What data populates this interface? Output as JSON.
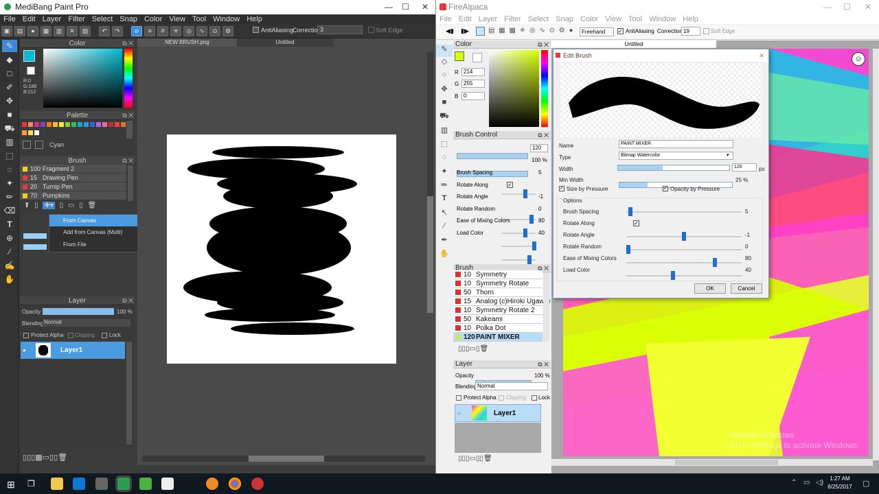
{
  "medibang": {
    "title": "MediBang Paint Pro",
    "menu": [
      "File",
      "Edit",
      "Layer",
      "Filter",
      "Select",
      "Snap",
      "Color",
      "View",
      "Tool",
      "Window",
      "Help"
    ],
    "toolbar": {
      "antialiasing": "AntiAliasing",
      "correction_label": "Correction",
      "correction_value": "3",
      "soft_edge": "Soft Edge"
    },
    "tabs": [
      "NEW BRUSH.png",
      "Untitled"
    ],
    "color_panel": {
      "title": "Color",
      "readout": "R:0\nG:188\nB:212",
      "accent": "#00bcd4"
    },
    "palette_panel": {
      "title": "Palette",
      "selected_name": "Cyan"
    },
    "brush_panel": {
      "title": "Brush",
      "items": [
        {
          "size": "100",
          "name": "Fragment 2",
          "color": "#f2d21b"
        },
        {
          "size": "15",
          "name": "Drawing Pen",
          "color": "#e03c3c"
        },
        {
          "size": "20",
          "name": "Turnip Pen",
          "color": "#e03c3c"
        },
        {
          "size": "70",
          "name": "Pumpkins",
          "color": "#f2d21b"
        }
      ]
    },
    "context_menu": [
      "From Canvas",
      "Add from Canvas (Multi)",
      "From File"
    ],
    "layer_panel": {
      "title": "Layer",
      "opacity_label": "Opacity",
      "opacity_value": "100 %",
      "blending_label": "Blending",
      "blending_value": "Normal",
      "protect_alpha": "Protect Alpha",
      "clipping": "Clipping",
      "lock": "Lock",
      "layer_name": "Layer1"
    }
  },
  "firealpaca": {
    "title": "FireAlpaca",
    "menu": [
      "File",
      "Edit",
      "Layer",
      "Filter",
      "Select",
      "Snap",
      "Color",
      "View",
      "Tool",
      "Window",
      "Help"
    ],
    "toolbar": {
      "mode": "Freehand",
      "antialiasing": "AntiAliasing",
      "correction_label": "Correction",
      "correction_value": "19",
      "soft_edge": "Soft Edge"
    },
    "tab": "Untitled",
    "color_panel": {
      "title": "Color",
      "r_label": "R",
      "r": "214",
      "g_label": "G",
      "g": "255",
      "b_label": "B",
      "b": "0",
      "current_color": "#d6ff00"
    },
    "brush_control": {
      "title": "Brush Control",
      "size": "120",
      "opacity": "100 %",
      "rows": [
        {
          "label": "Brush Spacing",
          "value": "5"
        },
        {
          "label": "Rotate Along",
          "value": ""
        },
        {
          "label": "Rotate Angle",
          "value": "-1"
        },
        {
          "label": "Rotate Random",
          "value": "0"
        },
        {
          "label": "Ease of Mixing Colors",
          "value": "80"
        },
        {
          "label": "Load Color",
          "value": "40"
        }
      ]
    },
    "brush_list": {
      "title": "Brush",
      "items": [
        {
          "size": "10",
          "name": "Symmetry"
        },
        {
          "size": "10",
          "name": "Symmetry Rotate"
        },
        {
          "size": "50",
          "name": "Thorn"
        },
        {
          "size": "15",
          "name": "Analog (c)Hiroki Ugawa)"
        },
        {
          "size": "10",
          "name": "Symmetry Rotate 2"
        },
        {
          "size": "50",
          "name": "Kakeami"
        },
        {
          "size": "10",
          "name": "Polka Dot"
        },
        {
          "size": "120",
          "name": "PAINT MIXER"
        }
      ]
    },
    "layer_panel": {
      "title": "Layer",
      "opacity_label": "Opacity",
      "opacity_value": "100 %",
      "blending_label": "Blending",
      "blending_value": "Normal",
      "protect_alpha": "Protect Alpha",
      "clipping": "Clipping",
      "lock": "Lock",
      "layer_name": "Layer1"
    },
    "watermark": "Activate Windows\nGo to Settings to activate Windows."
  },
  "edit_brush": {
    "title": "Edit Brush",
    "name_label": "Name",
    "name_value": "PAINT MIXER",
    "type_label": "Type",
    "type_value": "Bitmap Watercolor",
    "width_label": "Width",
    "width_value": "120",
    "width_unit": "px",
    "min_width_label": "Min Width",
    "min_width_value": "25 %",
    "size_by_pressure": "Size by Pressure",
    "opacity_by_pressure": "Opacity by Pressure",
    "options_label": "Options",
    "rows": [
      {
        "label": "Brush Spacing",
        "value": "5",
        "level": 0.02
      },
      {
        "label": "Rotate Along",
        "value": ""
      },
      {
        "label": "Rotate Angle",
        "value": "-1",
        "level": 0.5
      },
      {
        "label": "Rotate Random",
        "value": "0",
        "level": 0
      },
      {
        "label": "Ease of Mixing Colors",
        "value": "80",
        "level": 0.78
      },
      {
        "label": "Load Color",
        "value": "40",
        "level": 0.4
      }
    ],
    "ok": "OK",
    "cancel": "Cancel"
  },
  "taskbar": {
    "time": "1:27 AM",
    "date": "6/25/2017"
  }
}
